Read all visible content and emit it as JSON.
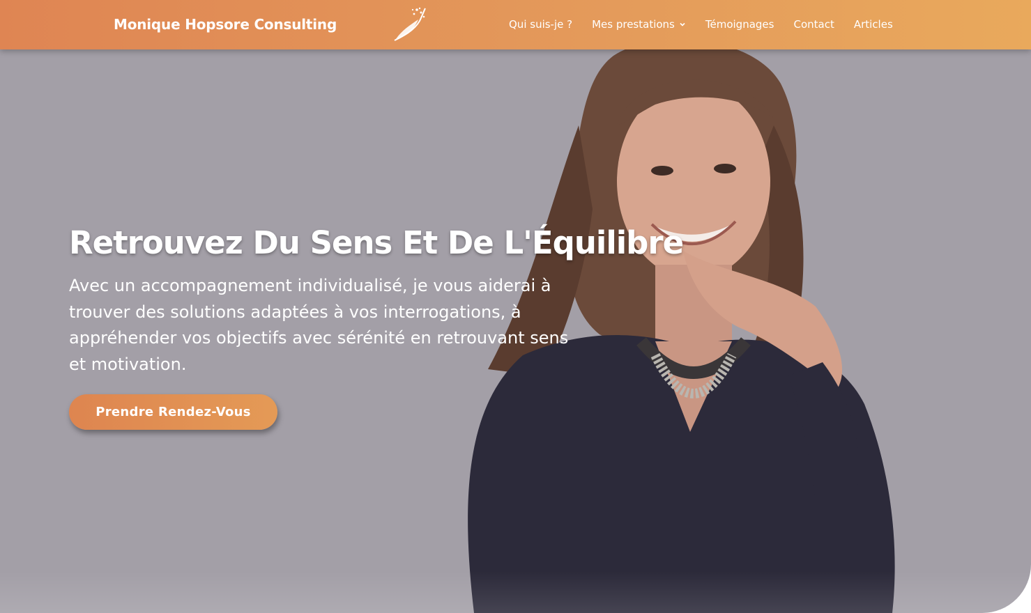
{
  "header": {
    "brand": "Monique Hopsore Consulting",
    "logo_icon": "feather-icon",
    "nav": [
      {
        "label": "Qui suis-je ?"
      },
      {
        "label": "Mes prestations",
        "has_dropdown": true
      },
      {
        "label": "Témoignages"
      },
      {
        "label": "Contact"
      },
      {
        "label": "Articles"
      }
    ]
  },
  "hero": {
    "title": "Retrouvez Du Sens Et De L'Équilibre",
    "text": "Avec un accompagnement individualisé, je vous aiderai à trouver des solutions adaptées à vos interrogations, à appréhender vos objectifs avec sérénité en retrouvant sens et motivation.",
    "cta_label": "Prendre Rendez-Vous"
  },
  "colors": {
    "header_start": "#df8553",
    "header_end": "#e9a95c",
    "hero_background": "#a39fa7",
    "text": "#ffffff"
  }
}
